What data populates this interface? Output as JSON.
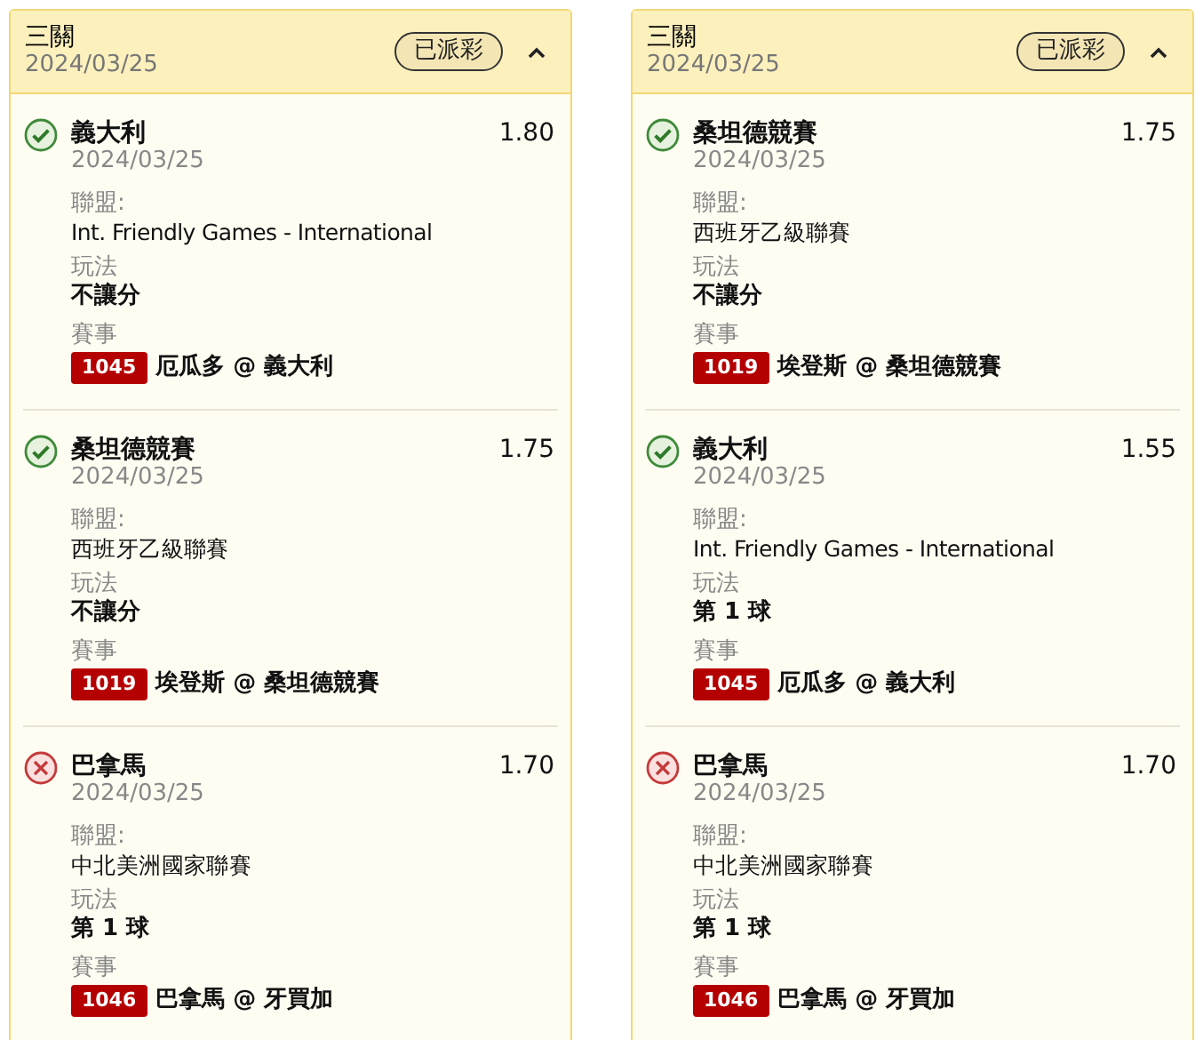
{
  "cards": [
    {
      "title": "三關",
      "date": "2024/03/25",
      "status": "已派彩",
      "expanded": true,
      "selections": [
        {
          "kind": "won",
          "name": "義大利",
          "date": "2024/03/25",
          "odds": "1.80",
          "league_label": "聯盟:",
          "league": "Int. Friendly Games - International",
          "bet_type_label": "玩法",
          "bet_type": "不讓分",
          "match_label": "賽事",
          "match_no": "1045",
          "match": "厄瓜多 @ 義大利"
        },
        {
          "kind": "won",
          "name": "桑坦德競賽",
          "date": "2024/03/25",
          "odds": "1.75",
          "league_label": "聯盟:",
          "league": "西班牙乙級聯賽",
          "bet_type_label": "玩法",
          "bet_type": "不讓分",
          "match_label": "賽事",
          "match_no": "1019",
          "match": "埃登斯 @ 桑坦德競賽"
        },
        {
          "kind": "lost",
          "name": "巴拿馬",
          "date": "2024/03/25",
          "odds": "1.70",
          "league_label": "聯盟:",
          "league": "中北美洲國家聯賽",
          "bet_type_label": "玩法",
          "bet_type": "第 1 球",
          "match_label": "賽事",
          "match_no": "1046",
          "match": "巴拿馬 @ 牙買加"
        }
      ]
    },
    {
      "title": "三關",
      "date": "2024/03/25",
      "status": "已派彩",
      "expanded": true,
      "selections": [
        {
          "kind": "won",
          "name": "桑坦德競賽",
          "date": "2024/03/25",
          "odds": "1.75",
          "league_label": "聯盟:",
          "league": "西班牙乙級聯賽",
          "bet_type_label": "玩法",
          "bet_type": "不讓分",
          "match_label": "賽事",
          "match_no": "1019",
          "match": "埃登斯 @ 桑坦德競賽"
        },
        {
          "kind": "won",
          "name": "義大利",
          "date": "2024/03/25",
          "odds": "1.55",
          "league_label": "聯盟:",
          "league": "Int. Friendly Games - International",
          "bet_type_label": "玩法",
          "bet_type": "第 1 球",
          "match_label": "賽事",
          "match_no": "1045",
          "match": "厄瓜多 @ 義大利"
        },
        {
          "kind": "lost",
          "name": "巴拿馬",
          "date": "2024/03/25",
          "odds": "1.70",
          "league_label": "聯盟:",
          "league": "中北美洲國家聯賽",
          "bet_type_label": "玩法",
          "bet_type": "第 1 球",
          "match_label": "賽事",
          "match_no": "1046",
          "match": "巴拿馬 @ 牙買加"
        }
      ]
    }
  ]
}
